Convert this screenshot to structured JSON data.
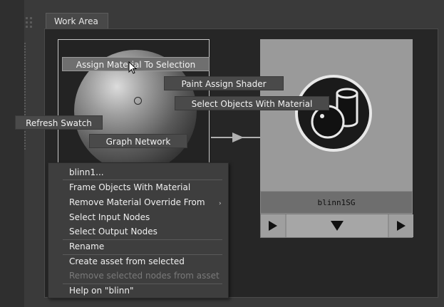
{
  "tab": {
    "label": "Work Area"
  },
  "marking_menu": {
    "assign_material": "Assign Material To Selection",
    "paint_assign": "Paint Assign Shader",
    "select_objects": "Select Objects With Material",
    "refresh_swatch": "Refresh Swatch",
    "graph_network": "Graph Network"
  },
  "shading_group": {
    "name": "blinn1SG"
  },
  "context_menu": {
    "items": [
      {
        "label": "blinn1...",
        "enabled": true
      },
      {
        "label": "Frame Objects With Material",
        "enabled": true
      },
      {
        "label": "Remove Material Override From",
        "enabled": true,
        "submenu": true
      },
      {
        "label": "Select Input Nodes",
        "enabled": true
      },
      {
        "label": "Select Output Nodes",
        "enabled": true
      },
      {
        "label": "Rename",
        "enabled": true
      },
      {
        "label": "Create asset from selected",
        "enabled": true
      },
      {
        "label": "Remove selected nodes from asset",
        "enabled": false
      },
      {
        "label": "Help on \"blinn\"",
        "enabled": true
      }
    ]
  },
  "icons": {
    "cursor": "mouse-pointer-icon",
    "submenu": "submenu-arrow-icon",
    "port_left": "play-right-icon",
    "port_mid": "triangle-down-icon",
    "port_right": "play-right-icon",
    "sg": "shading-group-icon"
  }
}
